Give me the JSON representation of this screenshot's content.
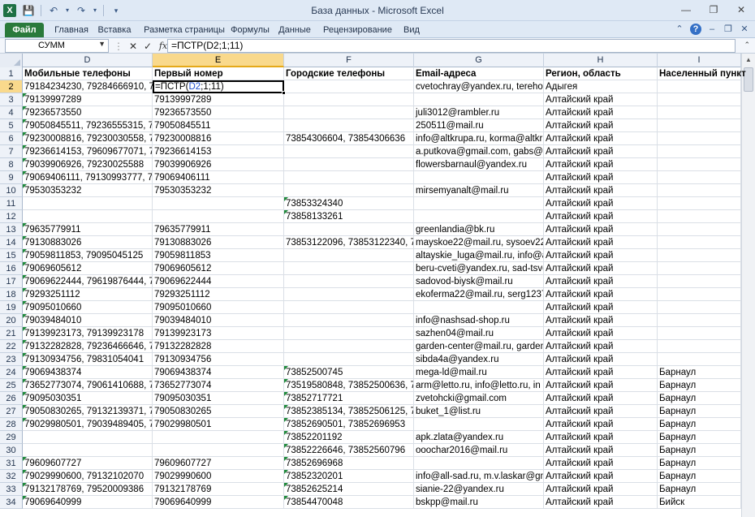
{
  "window": {
    "title": "База данных  -  Microsoft Excel",
    "app_icon": "X",
    "qat_icons": [
      "save-icon",
      "undo-icon",
      "redo-icon",
      "customize-icon"
    ],
    "controls": {
      "minimize": "—",
      "restore": "❐",
      "close": "✕"
    }
  },
  "ribbon": {
    "file_tab": "Файл",
    "tabs": [
      "Главная",
      "Вставка",
      "Разметка страницы",
      "Формулы",
      "Данные",
      "Рецензирование",
      "Вид"
    ],
    "right_icons": [
      "minimize-ribbon-icon",
      "help-icon",
      "restore-icon",
      "minimize-icon",
      "close-icon"
    ]
  },
  "formula_bar": {
    "name_box": "СУММ",
    "cancel": "✕",
    "enter": "✓",
    "fx": "fx",
    "formula": "=ПСТР(D2;1;11)"
  },
  "grid": {
    "columns": [
      "D",
      "E",
      "F",
      "G",
      "H",
      "I"
    ],
    "active_column": "E",
    "active_row": "2",
    "active_cell": {
      "prefix": "=ПСТР(",
      "ref": "D2",
      "suffix": ";1;11)"
    },
    "rows": [
      {
        "n": "1",
        "d": "Мобильные телефоны",
        "e": "Первый номер",
        "f": "Городские телефоны",
        "g": "Email-адреса",
        "h": "Регион, область",
        "i": "Населенный пункт"
      },
      {
        "n": "2",
        "d": "79184234230, 79284666910, 79671",
        "e": "",
        "f": "",
        "g": "cvetochray@yandex.ru, terehova",
        "h": "Адыгея",
        "i": ""
      },
      {
        "n": "3",
        "d": "79139997289",
        "e": "79139997289",
        "f": "",
        "g": "",
        "h": "Алтайский край",
        "i": ""
      },
      {
        "n": "4",
        "d": "79236573550",
        "e": "79236573550",
        "f": "",
        "g": "juli3012@rambler.ru",
        "h": "Алтайский край",
        "i": ""
      },
      {
        "n": "5",
        "d": "79050845511, 79236555315, 79631",
        "e": "79050845511",
        "f": "",
        "g": "250511@mail.ru",
        "h": "Алтайский край",
        "i": ""
      },
      {
        "n": "6",
        "d": "79230008816, 79230030558, 79231",
        "e": "79230008816",
        "f": "73854306604, 73854306636",
        "g": "info@altkrupa.ru, korma@altkru",
        "h": "Алтайский край",
        "i": ""
      },
      {
        "n": "7",
        "d": "79236614153, 79609677071, 79621",
        "e": "79236614153",
        "f": "",
        "g": "a.putkova@gmail.com, gabs@ma",
        "h": "Алтайский край",
        "i": ""
      },
      {
        "n": "8",
        "d": "79039906926, 79230025588",
        "e": "79039906926",
        "f": "",
        "g": "flowersbarnaul@yandex.ru",
        "h": "Алтайский край",
        "i": ""
      },
      {
        "n": "9",
        "d": "79069406111, 79130993777, 79231",
        "e": "79069406111",
        "f": "",
        "g": "",
        "h": "Алтайский край",
        "i": ""
      },
      {
        "n": "10",
        "d": "79530353232",
        "e": "79530353232",
        "f": "",
        "g": "mirsemyanalt@mail.ru",
        "h": "Алтайский край",
        "i": ""
      },
      {
        "n": "11",
        "d": "",
        "e": "",
        "f": "73853324340",
        "g": "",
        "h": "Алтайский край",
        "i": ""
      },
      {
        "n": "12",
        "d": "",
        "e": "",
        "f": "73858133261",
        "g": "",
        "h": "Алтайский край",
        "i": ""
      },
      {
        "n": "13",
        "d": "79635779911",
        "e": "79635779911",
        "f": "",
        "g": "greenlandia@bk.ru",
        "h": "Алтайский край",
        "i": ""
      },
      {
        "n": "14",
        "d": "79130883026",
        "e": "79130883026",
        "f": "73853122096, 73853122340, 7385",
        "g": "mayskoe22@mail.ru, sysoev22@",
        "h": "Алтайский край",
        "i": ""
      },
      {
        "n": "15",
        "d": "79059811853, 79095045125",
        "e": "79059811853",
        "f": "",
        "g": "altayskie_luga@mail.ru, info@a",
        "h": "Алтайский край",
        "i": ""
      },
      {
        "n": "16",
        "d": "79069605612",
        "e": "79069605612",
        "f": "",
        "g": "beru-cveti@yandex.ru, sad-tsve",
        "h": "Алтайский край",
        "i": ""
      },
      {
        "n": "17",
        "d": "79069622444, 79619876444, 79611",
        "e": "79069622444",
        "f": "",
        "g": "sadovod-biysk@mail.ru",
        "h": "Алтайский край",
        "i": ""
      },
      {
        "n": "18",
        "d": "79293251112",
        "e": "79293251112",
        "f": "",
        "g": "ekoferma22@mail.ru, serg12370",
        "h": "Алтайский край",
        "i": ""
      },
      {
        "n": "19",
        "d": "79095010660",
        "e": "79095010660",
        "f": "",
        "g": "",
        "h": "Алтайский край",
        "i": ""
      },
      {
        "n": "20",
        "d": "79039484010",
        "e": "79039484010",
        "f": "",
        "g": "info@nashsad-shop.ru",
        "h": "Алтайский край",
        "i": ""
      },
      {
        "n": "21",
        "d": "79139923173, 79139923178",
        "e": "79139923173",
        "f": "",
        "g": "sazhen04@mail.ru",
        "h": "Алтайский край",
        "i": ""
      },
      {
        "n": "22",
        "d": "79132282828, 79236466646, 79631",
        "e": "79132282828",
        "f": "",
        "g": "garden-center@mail.ru, garden",
        "h": "Алтайский край",
        "i": ""
      },
      {
        "n": "23",
        "d": "79130934756, 79831054041",
        "e": "79130934756",
        "f": "",
        "g": "sibda4a@yandex.ru",
        "h": "Алтайский край",
        "i": ""
      },
      {
        "n": "24",
        "d": "79069438374",
        "e": "79069438374",
        "f": "73852500745",
        "g": "mega-ld@mail.ru",
        "h": "Алтайский край",
        "i": "Барнаул"
      },
      {
        "n": "25",
        "d": "73652773074, 79061410688, 79061",
        "e": "73652773074",
        "f": "73519580848, 73852500636, 7385",
        "g": "arm@letto.ru, info@letto.ru, in",
        "h": "Алтайский край",
        "i": "Барнаул"
      },
      {
        "n": "26",
        "d": "79095030351",
        "e": "79095030351",
        "f": "73852717721",
        "g": "zvetohcki@gmail.com",
        "h": "Алтайский край",
        "i": "Барнаул"
      },
      {
        "n": "27",
        "d": "79050830265, 79132139371, 79631",
        "e": "79050830265",
        "f": "73852385134, 73852506125, 7385",
        "g": "buket_1@list.ru",
        "h": "Алтайский край",
        "i": "Барнаул"
      },
      {
        "n": "28",
        "d": "79029980501, 79039489405, 79061",
        "e": "79029980501",
        "f": "73852690501, 73852696953",
        "g": "",
        "h": "Алтайский край",
        "i": "Барнаул"
      },
      {
        "n": "29",
        "d": "",
        "e": "",
        "f": "73852201192",
        "g": "apk.zlata@yandex.ru",
        "h": "Алтайский край",
        "i": "Барнаул"
      },
      {
        "n": "30",
        "d": "",
        "e": "",
        "f": "73852226646, 73852560796",
        "g": "ooochar2016@mail.ru",
        "h": "Алтайский край",
        "i": "Барнаул"
      },
      {
        "n": "31",
        "d": "79609607727",
        "e": "79609607727",
        "f": "73852696968",
        "g": "",
        "h": "Алтайский край",
        "i": "Барнаул"
      },
      {
        "n": "32",
        "d": "79029990600, 79132102070",
        "e": "79029990600",
        "f": "73852320201",
        "g": "info@all-sad.ru, m.v.laskar@gm",
        "h": "Алтайский край",
        "i": "Барнаул"
      },
      {
        "n": "33",
        "d": "79132178769, 79520009386",
        "e": "79132178769",
        "f": "73852625214",
        "g": "sianie-22@yandex.ru",
        "h": "Алтайский край",
        "i": "Барнаул"
      },
      {
        "n": "34",
        "d": "79069640999",
        "e": "79069640999",
        "f": "73854470048",
        "g": "bskpp@mail.ru",
        "h": "Алтайский край",
        "i": "Бийск"
      }
    ],
    "triangle_cells": [
      "D3",
      "D4",
      "D5",
      "D6",
      "D7",
      "D8",
      "D9",
      "D10",
      "F11",
      "F12",
      "D13",
      "D14",
      "D15",
      "D16",
      "D17",
      "D18",
      "D19",
      "D20",
      "D21",
      "D22",
      "D23",
      "D24",
      "D25",
      "D26",
      "D27",
      "D28",
      "F24",
      "F25",
      "F26",
      "F27",
      "F28",
      "F29",
      "F30",
      "D31",
      "F31",
      "D32",
      "F32",
      "D33",
      "F33",
      "D34",
      "F34"
    ]
  }
}
